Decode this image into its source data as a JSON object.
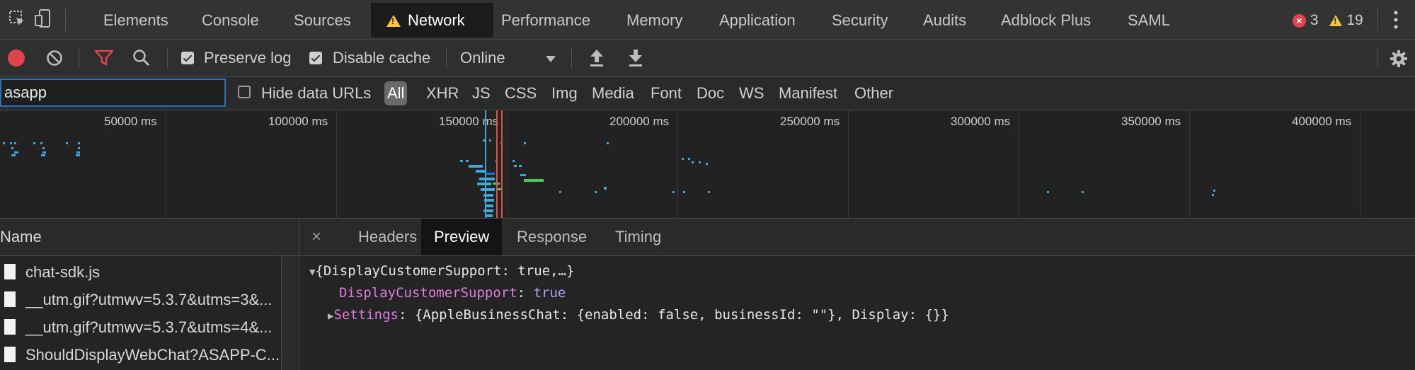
{
  "tabs": [
    {
      "label": "Elements"
    },
    {
      "label": "Console"
    },
    {
      "label": "Sources"
    },
    {
      "label": "Network"
    },
    {
      "label": "Performance"
    },
    {
      "label": "Memory"
    },
    {
      "label": "Application"
    },
    {
      "label": "Security"
    },
    {
      "label": "Audits"
    },
    {
      "label": "Adblock Plus"
    },
    {
      "label": "SAML"
    }
  ],
  "status": {
    "errors": "3",
    "warnings": "19"
  },
  "toolbar": {
    "preserve_log": "Preserve log",
    "disable_cache": "Disable cache",
    "throttle": "Online"
  },
  "filter": {
    "search_value": "asapp",
    "hide_data_urls": "Hide data URLs",
    "types": [
      "All",
      "XHR",
      "JS",
      "CSS",
      "Img",
      "Media",
      "Font",
      "Doc",
      "WS",
      "Manifest",
      "Other"
    ]
  },
  "overview": {
    "ticks": [
      "50000 ms",
      "100000 ms",
      "150000 ms",
      "200000 ms",
      "250000 ms",
      "300000 ms",
      "350000 ms",
      "400000 ms"
    ]
  },
  "requests": {
    "header": "Name",
    "rows": [
      {
        "name": "chat-sdk.js"
      },
      {
        "name": "__utm.gif?utmwv=5.3.7&utms=3&..."
      },
      {
        "name": "__utm.gif?utmwv=5.3.7&utms=4&..."
      },
      {
        "name": "ShouldDisplayWebChat?ASAPP-C..."
      }
    ]
  },
  "detail": {
    "close": "×",
    "tabs": [
      "Headers",
      "Preview",
      "Response",
      "Timing"
    ],
    "preview": {
      "root": "{DisplayCustomerSupport: true,…}",
      "line1_key": "DisplayCustomerSupport",
      "line1_sep": ": ",
      "line1_val": "true",
      "line2_key": "Settings",
      "line2_val": ": {AppleBusinessChat: {enabled: false, businessId: \"\"}, Display: {}}"
    }
  },
  "colors": {
    "accent": "#2d6fb5",
    "record": "#e0434b",
    "filter_icon": "#e0434b",
    "warning": "#f6c343",
    "string_key": "#e07be0",
    "keyword": "#b59cf5"
  }
}
